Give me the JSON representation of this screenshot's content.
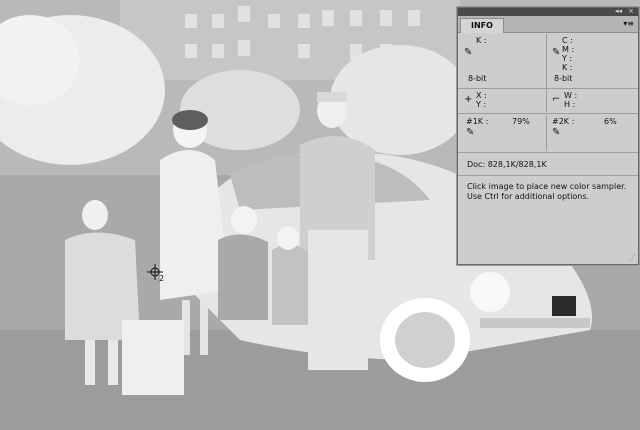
{
  "panel": {
    "tab": "INFO",
    "collapse_icon": "◂◂",
    "close_icon": "×",
    "menu_icon": "▾≡",
    "color": {
      "left": {
        "k": "K :",
        "bit": "8-bit"
      },
      "right": {
        "c": "C :",
        "m": "M :",
        "y": "Y :",
        "k": "K :",
        "bit": "8-bit"
      }
    },
    "xy": {
      "x": "X :",
      "y": "Y :",
      "w": "W :",
      "h": "H :"
    },
    "samplers": {
      "s1": {
        "label": "#1K :",
        "value": "79%"
      },
      "s2": {
        "label": "#2K :",
        "value": "6%"
      }
    },
    "doc": "Doc: 828,1K/828,1K",
    "hint1": "Click image to place new color sampler.",
    "hint2": "Use Ctrl for additional options."
  },
  "marker": {
    "label": "2"
  },
  "colors": {
    "panel_bg": "#cdcdcd",
    "titlebar": "#4a4a4a"
  }
}
